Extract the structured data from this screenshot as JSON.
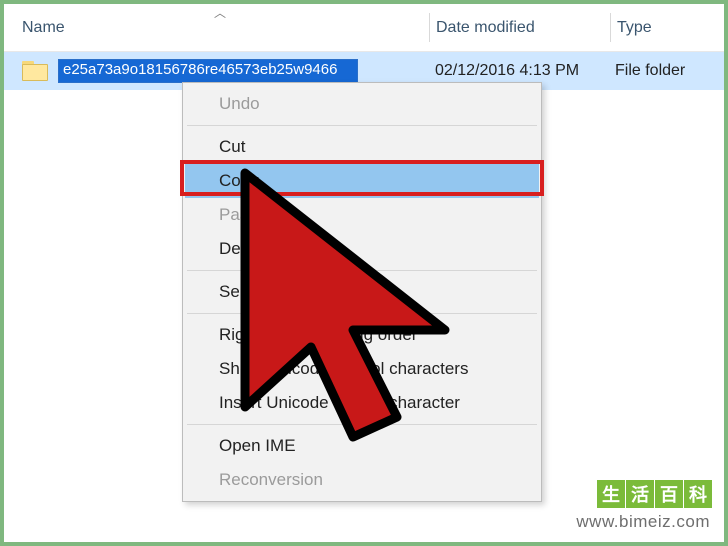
{
  "columns": {
    "name": "Name",
    "date": "Date modified",
    "type": "Type"
  },
  "file": {
    "rename_value": "e25a73a9o18156786re46573eb25w9466",
    "date_modified": "02/12/2016 4:13 PM",
    "type": "File folder"
  },
  "context_menu": {
    "undo": "Undo",
    "cut": "Cut",
    "copy": "Copy",
    "paste": "Paste",
    "delete": "Delete",
    "select_all": "Select All",
    "rtl": "Right to left Reading order",
    "show_unicode": "Show Unicode control characters",
    "insert_unicode": "Insert Unicode control character",
    "open_ime": "Open IME",
    "reconversion": "Reconversion"
  },
  "watermark": {
    "logo_chars": [
      "生",
      "活",
      "百",
      "科"
    ],
    "url": "www.bimeiz.com"
  }
}
